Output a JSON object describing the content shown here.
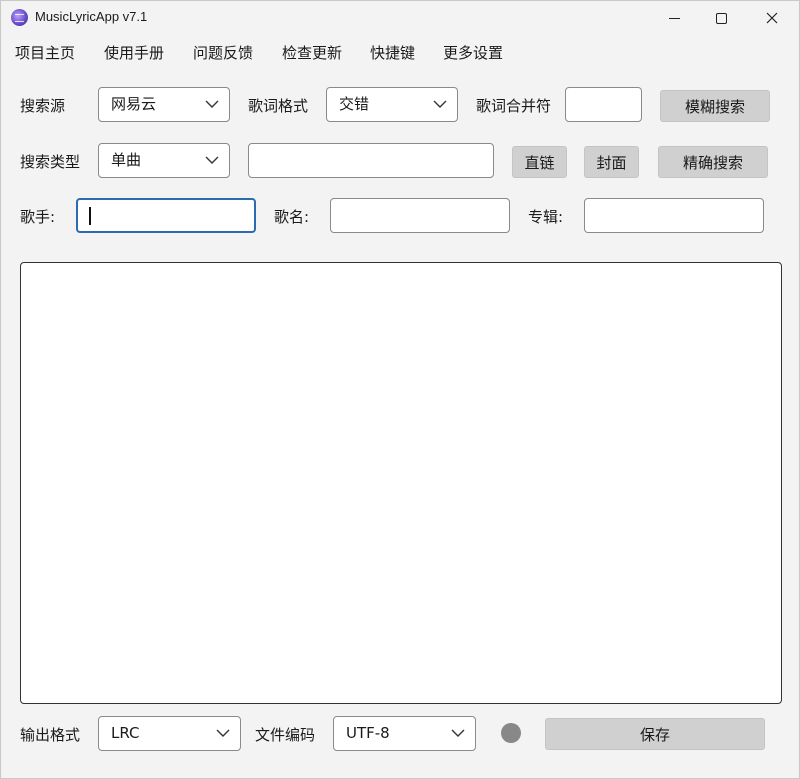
{
  "window": {
    "title": "MusicLyricApp v7.1"
  },
  "menu": [
    "项目主页",
    "使用手册",
    "问题反馈",
    "检查更新",
    "快捷键",
    "更多设置"
  ],
  "row1": {
    "source_label": "搜索源",
    "source_value": "网易云",
    "format_label": "歌词格式",
    "format_value": "交错",
    "merge_label": "歌词合并符",
    "merge_value": "",
    "fuzzy_search_label": "模糊搜索"
  },
  "row2": {
    "type_label": "搜索类型",
    "type_value": "单曲",
    "search_value": "",
    "direct_link_label": "直链",
    "cover_label": "封面",
    "exact_search_label": "精确搜索"
  },
  "row3": {
    "singer_label": "歌手:",
    "song_label": "歌名:",
    "album_label": "专辑:"
  },
  "bottom": {
    "output_format_label": "输出格式",
    "output_format_value": "LRC",
    "encoding_label": "文件编码",
    "encoding_value": "UTF-8",
    "save_label": "保存"
  },
  "colors": {
    "background": "#f3f3f3",
    "button": "#d0d0d0",
    "focus_border": "#2b6cb0",
    "status_dot": "#888888"
  }
}
